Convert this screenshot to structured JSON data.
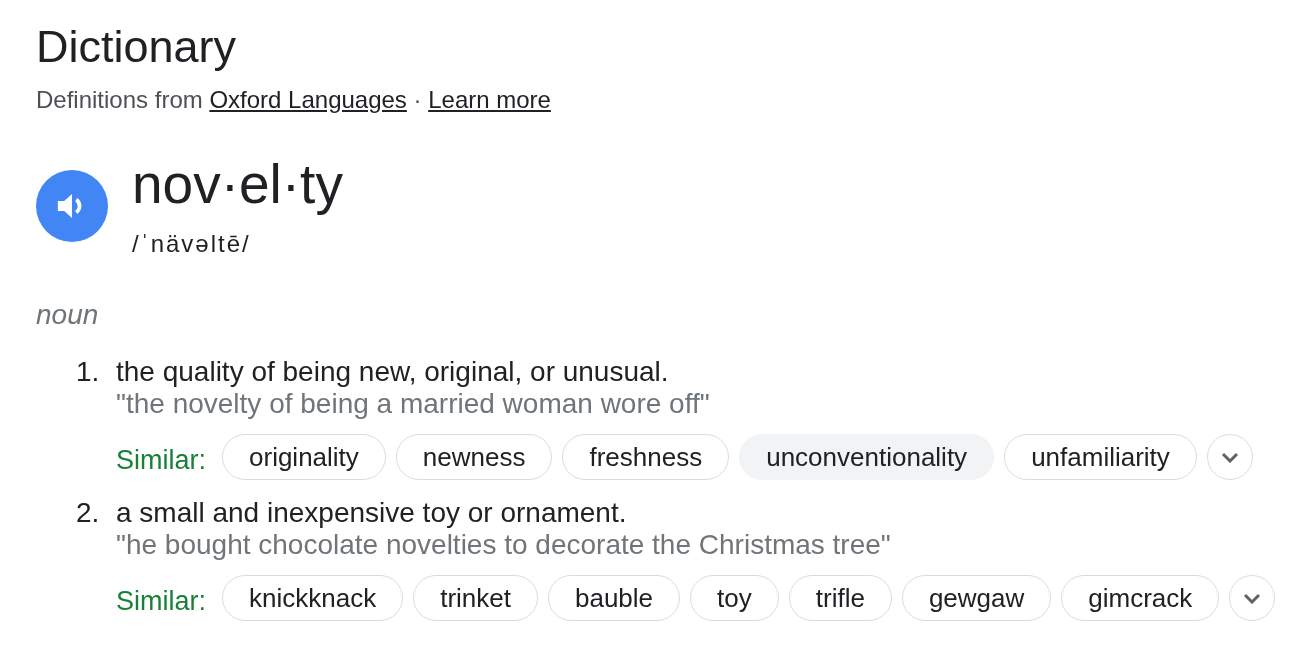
{
  "header": {
    "title": "Dictionary",
    "source_prefix": "Definitions from",
    "source_link": "Oxford Languages",
    "separator": "·",
    "learn_more": "Learn more"
  },
  "entry": {
    "headword": "nov·el·ty",
    "pronunciation": "/ˈnävəltē/",
    "part_of_speech": "noun"
  },
  "senses": [
    {
      "number": "1.",
      "definition": "the quality of being new, original, or unusual.",
      "example": "\"the novelty of being a married woman wore off\"",
      "similar_label": "Similar:",
      "similar": [
        {
          "word": "originality",
          "highlighted": false
        },
        {
          "word": "newness",
          "highlighted": false
        },
        {
          "word": "freshness",
          "highlighted": false
        },
        {
          "word": "unconventionality",
          "highlighted": true
        },
        {
          "word": "unfamiliarity",
          "highlighted": false
        }
      ]
    },
    {
      "number": "2.",
      "definition": "a small and inexpensive toy or ornament.",
      "example": "\"he bought chocolate novelties to decorate the Christmas tree\"",
      "similar_label": "Similar:",
      "similar": [
        {
          "word": "knickknack",
          "highlighted": false
        },
        {
          "word": "trinket",
          "highlighted": false
        },
        {
          "word": "bauble",
          "highlighted": false
        },
        {
          "word": "toy",
          "highlighted": false
        },
        {
          "word": "trifle",
          "highlighted": false
        },
        {
          "word": "gewgaw",
          "highlighted": false
        },
        {
          "word": "gimcrack",
          "highlighted": false
        }
      ]
    }
  ]
}
